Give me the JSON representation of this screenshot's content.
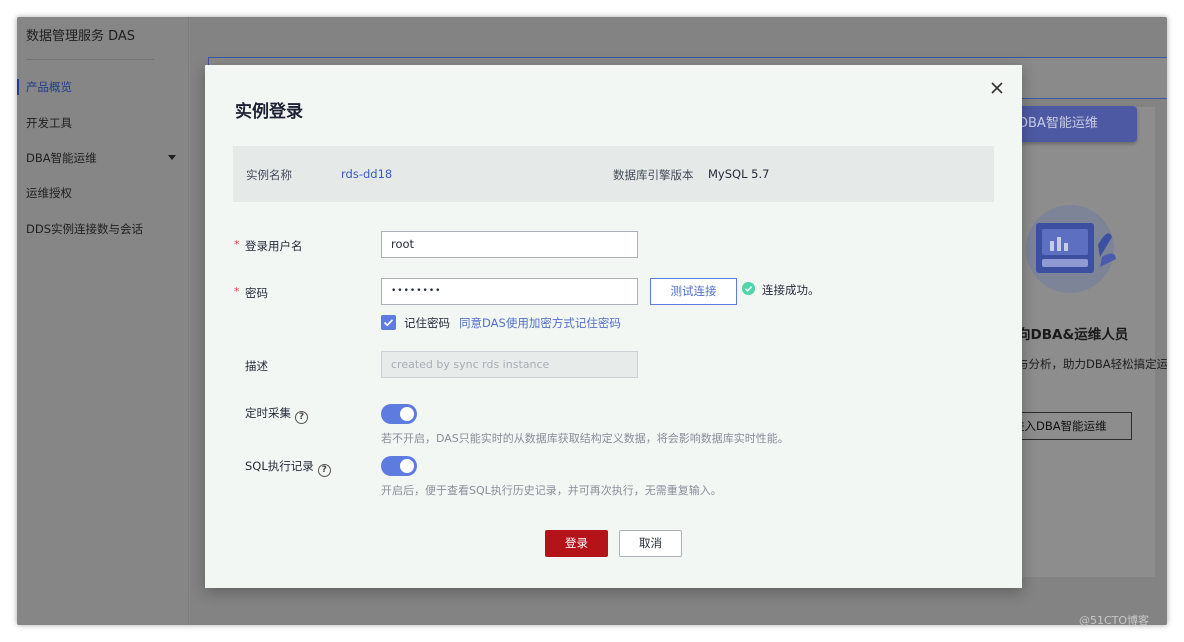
{
  "sidebar": {
    "title": "数据管理服务 DAS",
    "items": [
      {
        "label": "产品概览"
      },
      {
        "label": "开发工具"
      },
      {
        "label": "DBA智能运维"
      },
      {
        "label": "运维授权"
      },
      {
        "label": "DDS实例连接数与会话"
      }
    ]
  },
  "background": {
    "dba_button": "DBA智能运维",
    "heading": "向DBA&运维人员",
    "description": "与分析，助力DBA轻松搞定运",
    "enter_button": "进入DBA智能运维"
  },
  "watermark": "@51CTO博客",
  "dialog": {
    "title": "实例登录",
    "instance_name_label": "实例名称",
    "instance_name_value": "rds-dd18",
    "engine_version_label": "数据库引擎版本",
    "engine_version_value": "MySQL 5.7",
    "required_mark": "*",
    "username_label": "登录用户名",
    "username_value": "root",
    "password_label": "密码",
    "password_value": "••••••••",
    "test_button": "测试连接",
    "connection_status": "连接成功。",
    "remember_label": "记住密码",
    "remember_link": "同意DAS使用加密方式记住密码",
    "description_label": "描述",
    "description_placeholder": "created by sync rds instance",
    "scheduled_label": "定时采集",
    "scheduled_hint": "若不开启，DAS只能实时的从数据库获取结构定义数据，将会影响数据库实时性能。",
    "sql_label": "SQL执行记录",
    "sql_hint": "开启后，便于查看SQL执行历史记录，并可再次执行，无需重复输入。",
    "help_glyph": "?",
    "login_button": "登录",
    "cancel_button": "取消"
  },
  "colors": {
    "accent": "#5e7ce0",
    "primary_button": "#b5131a",
    "success": "#50d4ab",
    "link": "#526ecc"
  }
}
